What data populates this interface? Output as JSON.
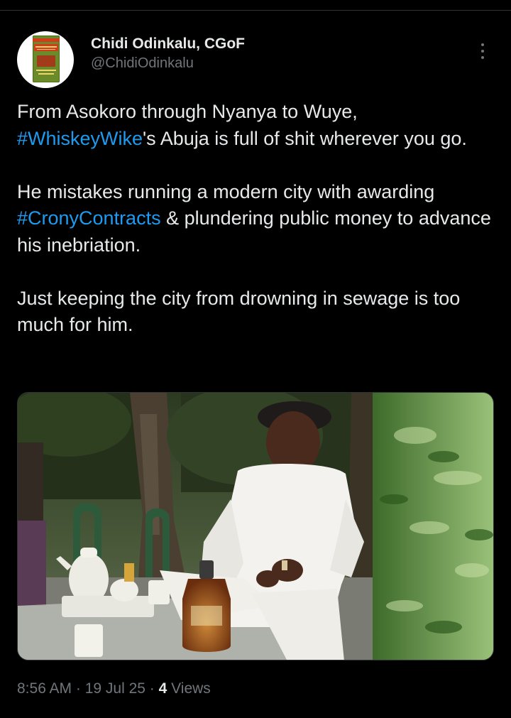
{
  "author": {
    "display_name": "Chidi Odinkalu, CGoF",
    "handle": "@ChidiOdinkalu",
    "avatar_book_text": {
      "top": "THE",
      "title": "SELECTORATE",
      "author": "CHIDI ANSELM ODINKALU"
    }
  },
  "menu": {
    "icon": "more-vertical-icon"
  },
  "tweet": {
    "p1_a": "From Asokoro through Nyanya to Wuye, ",
    "p1_tag": "#WhiskeyWike",
    "p1_b": "'s Abuja is full of shit wherever you go.",
    "p2_a": "He mistakes running a modern city with awarding ",
    "p2_tag": "#CronyContracts",
    "p2_b": " & plundering public money to advance his inebriation.",
    "p3": "Just keeping the city from drowning in sewage is too much for him."
  },
  "meta": {
    "time": "8:56 AM",
    "sep1": " · ",
    "date": "19 Jul 25",
    "sep2": " · ",
    "views_count": "4",
    "views_label": " Views"
  },
  "colors": {
    "background": "#000000",
    "text": "#e7e9ea",
    "muted": "#71767b",
    "link": "#1d9bf0"
  }
}
